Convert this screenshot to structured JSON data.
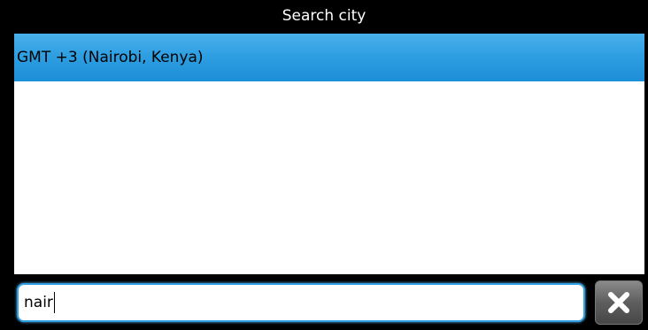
{
  "header": {
    "title": "Search city"
  },
  "results": {
    "items": [
      {
        "label": "GMT +3 (Nairobi, Kenya)",
        "selected": true
      }
    ]
  },
  "search": {
    "value": "nair"
  },
  "clear_button": {
    "icon": "close-icon"
  },
  "colors": {
    "selection": "#2f9fe2",
    "input_border": "#2f9fe2",
    "background": "#000000"
  }
}
